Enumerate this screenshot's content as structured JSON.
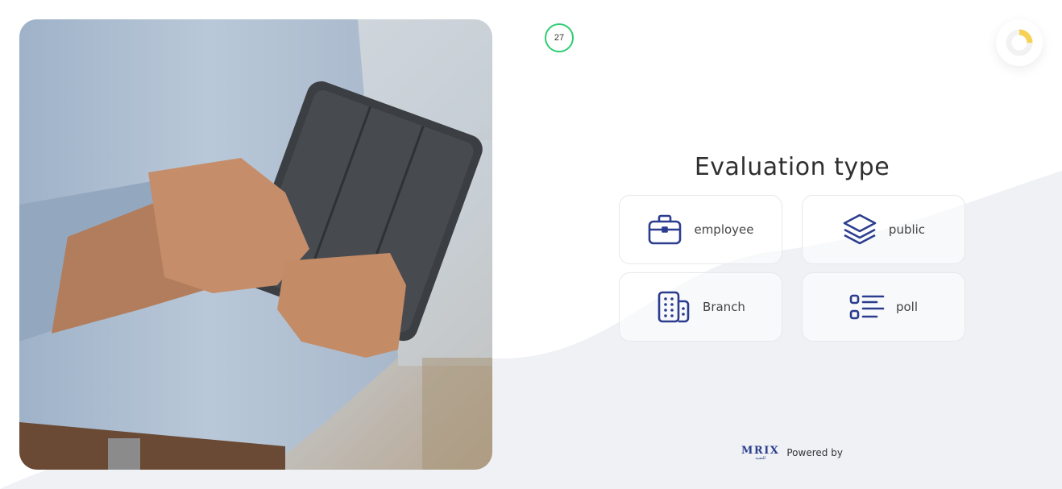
{
  "timer": {
    "value": "27",
    "color": "#2ecc71"
  },
  "progress": {
    "fraction": 0.25,
    "color": "#f7d154"
  },
  "title": "Evaluation type",
  "options": [
    {
      "label": "employee",
      "icon": "briefcase-icon"
    },
    {
      "label": "public",
      "icon": "layers-icon"
    },
    {
      "label": "Branch",
      "icon": "building-icon"
    },
    {
      "label": "poll",
      "icon": "list-icon"
    }
  ],
  "footer": {
    "logo_text": "MRIX",
    "logo_subtext": "للتقنية",
    "powered_by": "Powered by"
  },
  "colors": {
    "accent": "#2b3d8f",
    "background_wave": "#eff1f4",
    "card_border": "#e6e8ec"
  }
}
